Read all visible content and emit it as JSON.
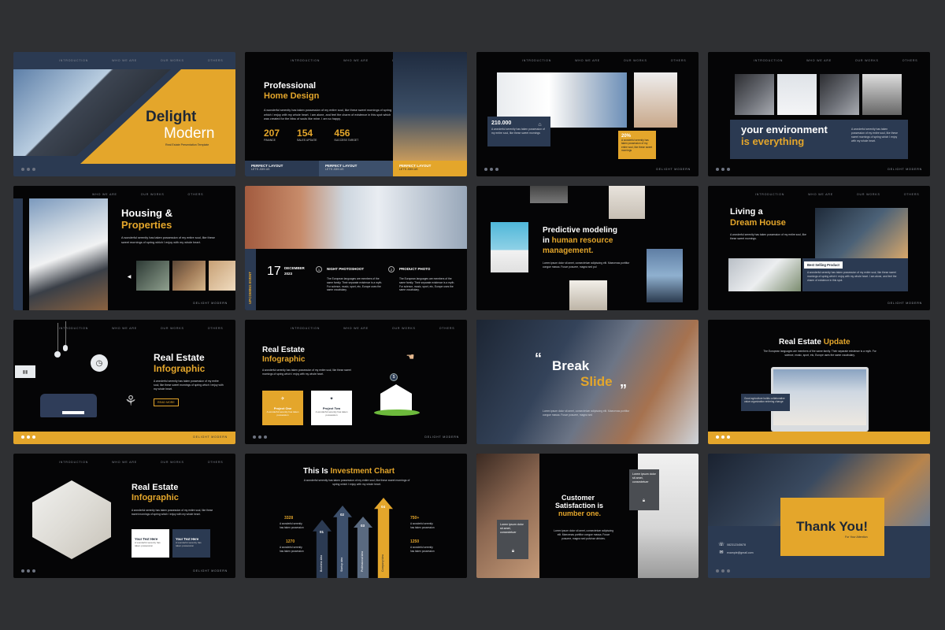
{
  "nav": [
    "INTRODUCTION",
    "WHO WE ARE",
    "OUR WORKS",
    "OTHERS"
  ],
  "brand": "DELIGHT MODERN",
  "colors": {
    "accent": "#e4a62b",
    "navy": "#2b3a52",
    "bg": "#050506",
    "page": "#2f3033"
  },
  "s1": {
    "title1": "Delight",
    "title2": "Modern",
    "sub": "Real Estate Presentation Template"
  },
  "s2": {
    "title1": "Professional",
    "title2": "Home Design",
    "body": "A wonderful serenity has taken possession of my entire soul, like these sweet mornings of spring which I enjoy with my whole heart. I am alone, and feel the charm of existence in this spot which was created for the bliss of souls like mine. I am so happy.",
    "stats": [
      {
        "num": "207",
        "label": "FINANCE"
      },
      {
        "num": "154",
        "label": "SALES UPDATE"
      },
      {
        "num": "456",
        "label": "SUCCESS TARGET"
      }
    ],
    "tabs": [
      {
        "title": "PERFECT LAYOUT",
        "sub": "LET'S JOIN US"
      },
      {
        "title": "PERFECT LAYOUT",
        "sub": "LET'S JOIN US"
      },
      {
        "title": "PERFECT LAYOUT",
        "sub": "LET'S JOIN US"
      }
    ]
  },
  "s3": {
    "stat1": "210.000",
    "stat1_body": "A wonderful serenity has taken possession of my entire soul, like these sweet mornings",
    "stat2": "20%",
    "stat2_body": "A wonderful serenity has taken possession of my entire soul, like these sweet mornings"
  },
  "s4": {
    "title1": "your environment",
    "title2": "is everything",
    "body": "A wonderful serenity has taken possession of my entire soul, like these sweet mornings of spring which I enjoy with my whole heart."
  },
  "s5": {
    "title1": "Housing &",
    "title2": "Properties",
    "body": "A wonderful serenity has taken possession of my entire soul, like these sweet mornings of spring which I enjoy with my whole heart.",
    "arrow": "◀"
  },
  "s6": {
    "side": "UPCOMING EVENT",
    "day": "17",
    "month": "DECEMBER",
    "year": "2023",
    "col1_title": "NIGHT PHOTOSHOOT",
    "col2_title": "PRODUCT PHOTO",
    "col_body": "The European languages are members of the same family. Their separate existence is a myth. For science, music, sport, etc, Europe uses the same vocabulary.",
    "n1": "1",
    "n2": "2"
  },
  "s7": {
    "title1": "Predictive modeling",
    "title2a": "in ",
    "title2b": "human resource",
    "title3": "management.",
    "body": "Lorem ipsum dolor sit amet, consectetuer adipiscing elit. Maecenas porttitor congue massa. Fusce posuere, magna sed pul"
  },
  "s8": {
    "title1": "Living a",
    "title2": "Dream House",
    "body": "A wonderful serenity has taken possession of my entire soul, like these sweet mornings.",
    "badge": "Best Selling Product",
    "badge_body": "A wonderful serenity has taken possession of my entire soul, like these sweet mornings of spring which I enjoy with my whole heart. I am alone, and feel the charm of existence in this spot."
  },
  "s9": {
    "title1": "Real Estate",
    "title2": "Infographic",
    "body": "A wonderful serenity has taken possession of my entire soul, like these sweet mornings of spring which I enjoy with my whole heart.",
    "button": "READ MORE"
  },
  "s10": {
    "title1": "Real Estate",
    "title2": "Infographic",
    "body": "A wonderful serenity has taken possession of my entire soul, like these sweet mornings of spring which I enjoy with my whole heart.",
    "card1_title": "Project One",
    "card1_body": "A wonderful serenity has taken possession",
    "card2_title": "Project Two",
    "card2_body": "A wonderful serenity has taken possession"
  },
  "s11": {
    "title1": "Break",
    "title2": "Slide",
    "q_open": "“",
    "q_close": "”",
    "body": "Lorem ipsum dolor sit amet, consectetuer adipiscing elit. Maecenas porttitor congue massa. Fusce posuere, magna sed"
  },
  "s12": {
    "title1": "Real Estate ",
    "title2": "Update",
    "body": "The European languages are members of the same family. Their separate existence is a myth. For science, music, sport, etc, Europe uses the same vocabulary.",
    "box": "Good agriculture builds collaborative value organization entering change"
  },
  "s13": {
    "title1": "Real Estate",
    "title2": "Infographic",
    "body": "A wonderful serenity has taken possession of my entire soul, like these sweet mornings of spring which I enjoy with my whole heart.",
    "box1_title": "Your Text Here",
    "box1_body": "A wonderful serenity has taken possession",
    "box2_title": "Your Text Here",
    "box2_body": "A wonderful serenity has taken possession"
  },
  "s14": {
    "title1": "This Is ",
    "title2": "Investment Chart",
    "body": "A wonderful serenity has taken possession of my entire soul, like these sweet mornings of spring which I enjoy with my whole heart.",
    "arrows": [
      {
        "n": "01",
        "label": "Business idea"
      },
      {
        "n": "02",
        "label": "Startup idea"
      },
      {
        "n": "03",
        "label": "Professional idea"
      },
      {
        "n": "04",
        "label": "Company idea"
      }
    ],
    "left": [
      {
        "num": "3328",
        "body": "A wonderful serenity has taken possession"
      },
      {
        "num": "1270",
        "body": "A wonderful serenity has taken possession"
      }
    ],
    "right": [
      {
        "num": "750+",
        "body": "A wonderful serenity has taken possession"
      },
      {
        "num": "1250",
        "body": "A wonderful serenity has taken possession"
      }
    ]
  },
  "s15": {
    "title1": "Customer",
    "title2": "Satisfaction is",
    "title3": "number one.",
    "body": "Lorem ipsum dolor sit amet, consectetuer adipiscing elit. Maecenas porttitor congue massa. Fusce posuere, magna sed pulvinar ultricies.",
    "box1": "Lorem ipsum dolor sit amet, consectetuer",
    "box2": "Lorem ipsum dolor sit amet, consectetuer"
  },
  "s16": {
    "title": "Thank You!",
    "sub": "For Your Attention",
    "phone": "082312345678",
    "email": "example@gmail.com"
  }
}
